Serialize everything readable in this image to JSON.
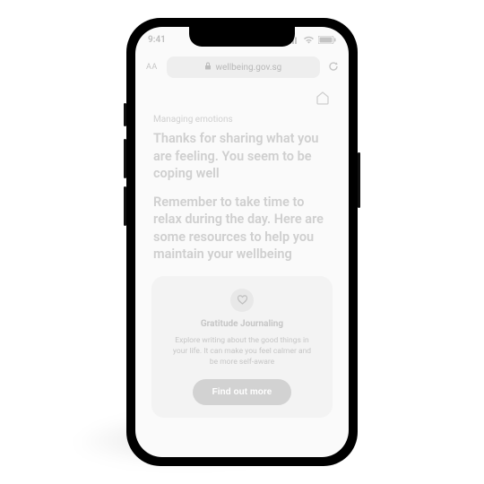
{
  "status": {
    "time": "9:41"
  },
  "browser": {
    "url": "wellbeing.gov.sg"
  },
  "page": {
    "eyebrow": "Managing emotions",
    "headline": "Thanks for sharing what you are feeling. You seem to be coping well",
    "paragraph": "Remember to take time to relax during the day. Here are some resources to help you maintain your wellbeing"
  },
  "card": {
    "title": "Gratitude Journaling",
    "body": "Explore writing about the good things in your life. It can make you feel calmer and be more self-aware",
    "cta": "Find out more"
  }
}
